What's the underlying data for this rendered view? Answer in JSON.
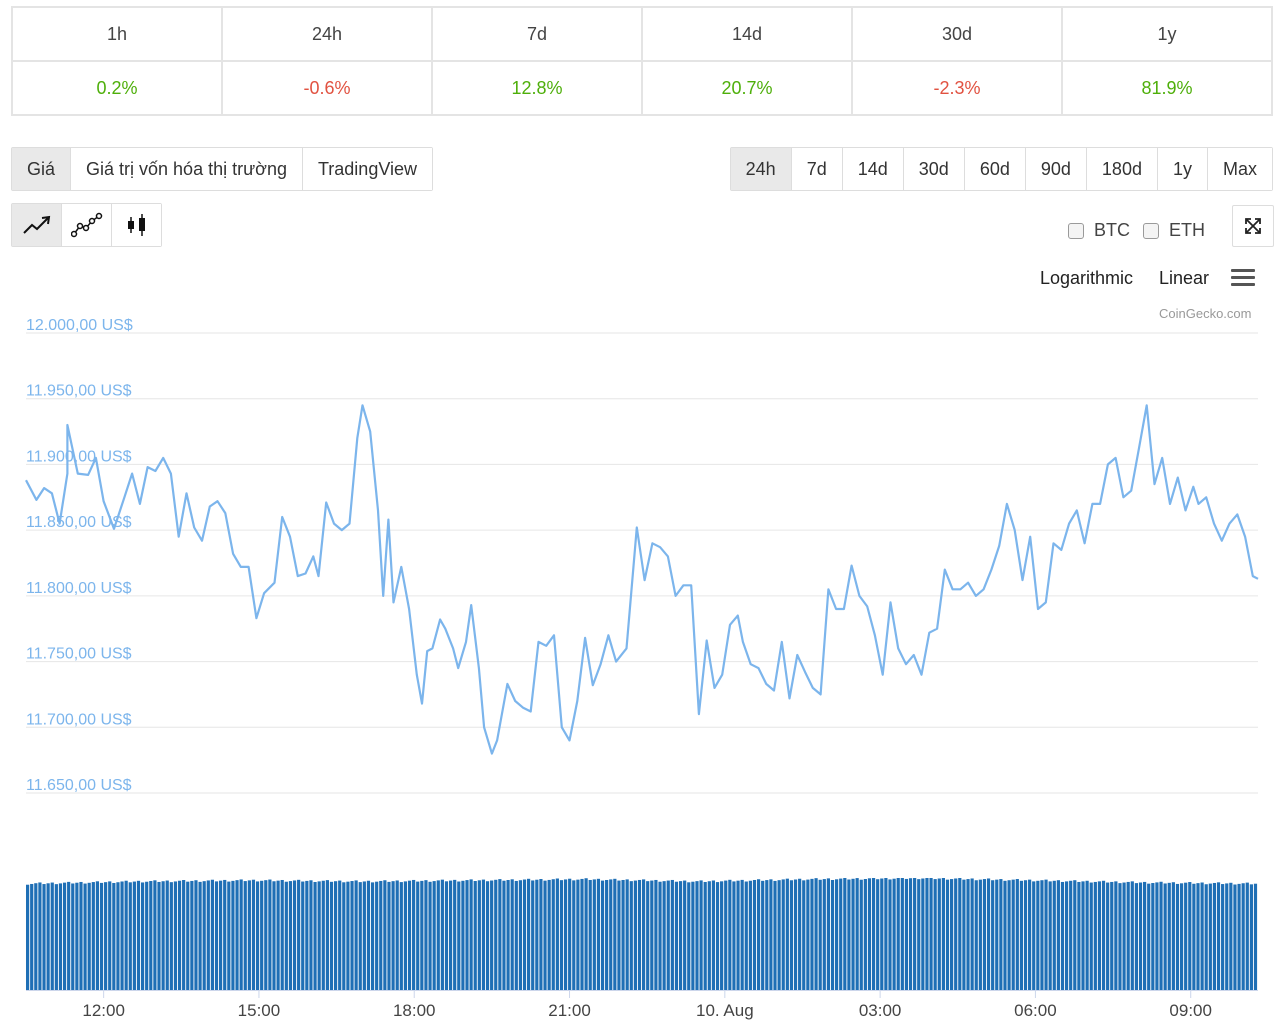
{
  "changes": {
    "headers": [
      "1h",
      "24h",
      "7d",
      "14d",
      "30d",
      "1y"
    ],
    "values": [
      "0.2%",
      "-0.6%",
      "12.8%",
      "20.7%",
      "-2.3%",
      "81.9%"
    ],
    "directions": [
      "up",
      "down",
      "up",
      "up",
      "down",
      "up"
    ]
  },
  "view_tabs": [
    "Giá",
    "Giá trị vốn hóa thị trường",
    "TradingView"
  ],
  "range_tabs": [
    "24h",
    "7d",
    "14d",
    "30d",
    "60d",
    "90d",
    "180d",
    "1y",
    "Max"
  ],
  "chart_types": [
    "line-chart-icon",
    "ohlc-line-icon",
    "candlestick-icon"
  ],
  "compare": {
    "btc": "BTC",
    "eth": "ETH"
  },
  "scale": {
    "log": "Logarithmic",
    "linear": "Linear"
  },
  "credits": "CoinGecko.com",
  "colors": {
    "line": "#7cb5ec",
    "volume": "#1f6fb5",
    "up": "#4eaf0a",
    "down": "#e15241"
  },
  "chart_data": {
    "type": "line",
    "ylim": [
      11650,
      12000
    ],
    "y_ticks": [
      {
        "value": 12000,
        "label": "12.000,00 US$"
      },
      {
        "value": 11950,
        "label": "11.950,00 US$"
      },
      {
        "value": 11900,
        "label": "11.900,00 US$"
      },
      {
        "value": 11850,
        "label": "11.850,00 US$"
      },
      {
        "value": 11800,
        "label": "11.800,00 US$"
      },
      {
        "value": 11750,
        "label": "11.750,00 US$"
      },
      {
        "value": 11700,
        "label": "11.700,00 US$"
      },
      {
        "value": 11650,
        "label": "11.650,00 US$"
      }
    ],
    "x_range_hours": [
      10.5,
      34.3
    ],
    "x_ticks": [
      {
        "value": 12,
        "label": "12:00"
      },
      {
        "value": 15,
        "label": "15:00"
      },
      {
        "value": 18,
        "label": "18:00"
      },
      {
        "value": 21,
        "label": "21:00"
      },
      {
        "value": 24,
        "label": "10. Aug"
      },
      {
        "value": 27,
        "label": "03:00"
      },
      {
        "value": 30,
        "label": "06:00"
      },
      {
        "value": 33,
        "label": "09:00"
      }
    ],
    "series": [
      {
        "name": "",
        "points": [
          [
            10.5,
            11888
          ],
          [
            10.7,
            11873
          ],
          [
            10.85,
            11882
          ],
          [
            11.0,
            11878
          ],
          [
            11.15,
            11855
          ],
          [
            11.3,
            11893
          ],
          [
            11.3,
            11930
          ],
          [
            11.5,
            11893
          ],
          [
            11.7,
            11892
          ],
          [
            11.85,
            11905
          ],
          [
            12.0,
            11872
          ],
          [
            12.2,
            11851
          ],
          [
            12.4,
            11875
          ],
          [
            12.55,
            11893
          ],
          [
            12.7,
            11870
          ],
          [
            12.85,
            11898
          ],
          [
            13.0,
            11895
          ],
          [
            13.15,
            11905
          ],
          [
            13.3,
            11893
          ],
          [
            13.45,
            11845
          ],
          [
            13.6,
            11878
          ],
          [
            13.75,
            11852
          ],
          [
            13.9,
            11842
          ],
          [
            14.05,
            11868
          ],
          [
            14.2,
            11872
          ],
          [
            14.35,
            11863
          ],
          [
            14.5,
            11832
          ],
          [
            14.65,
            11822
          ],
          [
            14.8,
            11822
          ],
          [
            14.95,
            11783
          ],
          [
            15.1,
            11802
          ],
          [
            15.3,
            11810
          ],
          [
            15.45,
            11860
          ],
          [
            15.6,
            11845
          ],
          [
            15.75,
            11815
          ],
          [
            15.9,
            11817
          ],
          [
            16.05,
            11830
          ],
          [
            16.15,
            11815
          ],
          [
            16.3,
            11871
          ],
          [
            16.45,
            11855
          ],
          [
            16.6,
            11850
          ],
          [
            16.75,
            11855
          ],
          [
            16.9,
            11920
          ],
          [
            17.0,
            11945
          ],
          [
            17.15,
            11925
          ],
          [
            17.3,
            11865
          ],
          [
            17.4,
            11800
          ],
          [
            17.5,
            11858
          ],
          [
            17.6,
            11795
          ],
          [
            17.75,
            11822
          ],
          [
            17.9,
            11790
          ],
          [
            18.05,
            11740
          ],
          [
            18.15,
            11718
          ],
          [
            18.25,
            11758
          ],
          [
            18.35,
            11760
          ],
          [
            18.5,
            11782
          ],
          [
            18.6,
            11775
          ],
          [
            18.75,
            11760
          ],
          [
            18.85,
            11745
          ],
          [
            19.0,
            11765
          ],
          [
            19.1,
            11793
          ],
          [
            19.25,
            11745
          ],
          [
            19.35,
            11700
          ],
          [
            19.5,
            11680
          ],
          [
            19.6,
            11690
          ],
          [
            19.8,
            11733
          ],
          [
            19.95,
            11720
          ],
          [
            20.1,
            11715
          ],
          [
            20.25,
            11712
          ],
          [
            20.4,
            11765
          ],
          [
            20.55,
            11762
          ],
          [
            20.7,
            11770
          ],
          [
            20.85,
            11700
          ],
          [
            21.0,
            11690
          ],
          [
            21.15,
            11720
          ],
          [
            21.3,
            11768
          ],
          [
            21.45,
            11732
          ],
          [
            21.6,
            11748
          ],
          [
            21.75,
            11770
          ],
          [
            21.9,
            11750
          ],
          [
            22.1,
            11760
          ],
          [
            22.3,
            11852
          ],
          [
            22.45,
            11812
          ],
          [
            22.6,
            11840
          ],
          [
            22.75,
            11837
          ],
          [
            22.9,
            11830
          ],
          [
            23.05,
            11800
          ],
          [
            23.2,
            11808
          ],
          [
            23.35,
            11808
          ],
          [
            23.5,
            11710
          ],
          [
            23.65,
            11766
          ],
          [
            23.8,
            11730
          ],
          [
            23.95,
            11740
          ],
          [
            24.1,
            11778
          ],
          [
            24.25,
            11785
          ],
          [
            24.35,
            11765
          ],
          [
            24.5,
            11748
          ],
          [
            24.65,
            11745
          ],
          [
            24.8,
            11733
          ],
          [
            24.95,
            11728
          ],
          [
            25.1,
            11765
          ],
          [
            25.25,
            11722
          ],
          [
            25.4,
            11755
          ],
          [
            25.55,
            11742
          ],
          [
            25.7,
            11730
          ],
          [
            25.85,
            11725
          ],
          [
            26.0,
            11805
          ],
          [
            26.15,
            11790
          ],
          [
            26.3,
            11790
          ],
          [
            26.45,
            11823
          ],
          [
            26.6,
            11800
          ],
          [
            26.75,
            11792
          ],
          [
            26.9,
            11770
          ],
          [
            27.05,
            11740
          ],
          [
            27.2,
            11795
          ],
          [
            27.35,
            11760
          ],
          [
            27.5,
            11748
          ],
          [
            27.65,
            11755
          ],
          [
            27.8,
            11740
          ],
          [
            27.95,
            11772
          ],
          [
            28.1,
            11775
          ],
          [
            28.25,
            11820
          ],
          [
            28.4,
            11805
          ],
          [
            28.55,
            11805
          ],
          [
            28.7,
            11810
          ],
          [
            28.85,
            11800
          ],
          [
            29.0,
            11805
          ],
          [
            29.15,
            11820
          ],
          [
            29.3,
            11838
          ],
          [
            29.45,
            11870
          ],
          [
            29.6,
            11850
          ],
          [
            29.75,
            11812
          ],
          [
            29.9,
            11845
          ],
          [
            30.05,
            11790
          ],
          [
            30.2,
            11795
          ],
          [
            30.35,
            11840
          ],
          [
            30.5,
            11835
          ],
          [
            30.65,
            11855
          ],
          [
            30.8,
            11865
          ],
          [
            30.95,
            11840
          ],
          [
            31.1,
            11870
          ],
          [
            31.25,
            11870
          ],
          [
            31.4,
            11900
          ],
          [
            31.55,
            11905
          ],
          [
            31.7,
            11875
          ],
          [
            31.85,
            11880
          ],
          [
            32.0,
            11912
          ],
          [
            32.15,
            11945
          ],
          [
            32.3,
            11885
          ],
          [
            32.45,
            11905
          ],
          [
            32.6,
            11870
          ],
          [
            32.75,
            11890
          ],
          [
            32.9,
            11865
          ],
          [
            33.05,
            11883
          ],
          [
            33.15,
            11870
          ],
          [
            33.3,
            11875
          ],
          [
            33.45,
            11855
          ],
          [
            33.6,
            11842
          ],
          [
            33.75,
            11855
          ],
          [
            33.9,
            11862
          ],
          [
            34.05,
            11845
          ],
          [
            34.2,
            11815
          ],
          [
            34.3,
            11813
          ]
        ]
      }
    ],
    "volume": {
      "bar_count": 300,
      "level_profile": [
        0.95,
        0.97,
        0.98,
        0.97,
        0.98,
        0.99,
        0.97,
        0.99,
        1.0,
        0.98,
        0.96,
        0.95
      ]
    }
  }
}
